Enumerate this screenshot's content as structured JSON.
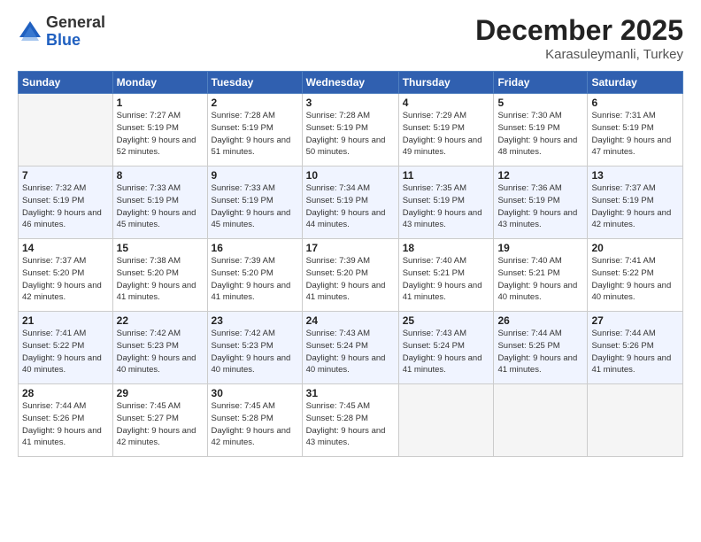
{
  "logo": {
    "general": "General",
    "blue": "Blue"
  },
  "title": "December 2025",
  "location": "Karasuleymanli, Turkey",
  "days_header": [
    "Sunday",
    "Monday",
    "Tuesday",
    "Wednesday",
    "Thursday",
    "Friday",
    "Saturday"
  ],
  "weeks": [
    [
      {
        "day": "",
        "sunrise": "",
        "sunset": "",
        "daylight": ""
      },
      {
        "day": "1",
        "sunrise": "Sunrise: 7:27 AM",
        "sunset": "Sunset: 5:19 PM",
        "daylight": "Daylight: 9 hours and 52 minutes."
      },
      {
        "day": "2",
        "sunrise": "Sunrise: 7:28 AM",
        "sunset": "Sunset: 5:19 PM",
        "daylight": "Daylight: 9 hours and 51 minutes."
      },
      {
        "day": "3",
        "sunrise": "Sunrise: 7:28 AM",
        "sunset": "Sunset: 5:19 PM",
        "daylight": "Daylight: 9 hours and 50 minutes."
      },
      {
        "day": "4",
        "sunrise": "Sunrise: 7:29 AM",
        "sunset": "Sunset: 5:19 PM",
        "daylight": "Daylight: 9 hours and 49 minutes."
      },
      {
        "day": "5",
        "sunrise": "Sunrise: 7:30 AM",
        "sunset": "Sunset: 5:19 PM",
        "daylight": "Daylight: 9 hours and 48 minutes."
      },
      {
        "day": "6",
        "sunrise": "Sunrise: 7:31 AM",
        "sunset": "Sunset: 5:19 PM",
        "daylight": "Daylight: 9 hours and 47 minutes."
      }
    ],
    [
      {
        "day": "7",
        "sunrise": "Sunrise: 7:32 AM",
        "sunset": "Sunset: 5:19 PM",
        "daylight": "Daylight: 9 hours and 46 minutes."
      },
      {
        "day": "8",
        "sunrise": "Sunrise: 7:33 AM",
        "sunset": "Sunset: 5:19 PM",
        "daylight": "Daylight: 9 hours and 45 minutes."
      },
      {
        "day": "9",
        "sunrise": "Sunrise: 7:33 AM",
        "sunset": "Sunset: 5:19 PM",
        "daylight": "Daylight: 9 hours and 45 minutes."
      },
      {
        "day": "10",
        "sunrise": "Sunrise: 7:34 AM",
        "sunset": "Sunset: 5:19 PM",
        "daylight": "Daylight: 9 hours and 44 minutes."
      },
      {
        "day": "11",
        "sunrise": "Sunrise: 7:35 AM",
        "sunset": "Sunset: 5:19 PM",
        "daylight": "Daylight: 9 hours and 43 minutes."
      },
      {
        "day": "12",
        "sunrise": "Sunrise: 7:36 AM",
        "sunset": "Sunset: 5:19 PM",
        "daylight": "Daylight: 9 hours and 43 minutes."
      },
      {
        "day": "13",
        "sunrise": "Sunrise: 7:37 AM",
        "sunset": "Sunset: 5:19 PM",
        "daylight": "Daylight: 9 hours and 42 minutes."
      }
    ],
    [
      {
        "day": "14",
        "sunrise": "Sunrise: 7:37 AM",
        "sunset": "Sunset: 5:20 PM",
        "daylight": "Daylight: 9 hours and 42 minutes."
      },
      {
        "day": "15",
        "sunrise": "Sunrise: 7:38 AM",
        "sunset": "Sunset: 5:20 PM",
        "daylight": "Daylight: 9 hours and 41 minutes."
      },
      {
        "day": "16",
        "sunrise": "Sunrise: 7:39 AM",
        "sunset": "Sunset: 5:20 PM",
        "daylight": "Daylight: 9 hours and 41 minutes."
      },
      {
        "day": "17",
        "sunrise": "Sunrise: 7:39 AM",
        "sunset": "Sunset: 5:20 PM",
        "daylight": "Daylight: 9 hours and 41 minutes."
      },
      {
        "day": "18",
        "sunrise": "Sunrise: 7:40 AM",
        "sunset": "Sunset: 5:21 PM",
        "daylight": "Daylight: 9 hours and 41 minutes."
      },
      {
        "day": "19",
        "sunrise": "Sunrise: 7:40 AM",
        "sunset": "Sunset: 5:21 PM",
        "daylight": "Daylight: 9 hours and 40 minutes."
      },
      {
        "day": "20",
        "sunrise": "Sunrise: 7:41 AM",
        "sunset": "Sunset: 5:22 PM",
        "daylight": "Daylight: 9 hours and 40 minutes."
      }
    ],
    [
      {
        "day": "21",
        "sunrise": "Sunrise: 7:41 AM",
        "sunset": "Sunset: 5:22 PM",
        "daylight": "Daylight: 9 hours and 40 minutes."
      },
      {
        "day": "22",
        "sunrise": "Sunrise: 7:42 AM",
        "sunset": "Sunset: 5:23 PM",
        "daylight": "Daylight: 9 hours and 40 minutes."
      },
      {
        "day": "23",
        "sunrise": "Sunrise: 7:42 AM",
        "sunset": "Sunset: 5:23 PM",
        "daylight": "Daylight: 9 hours and 40 minutes."
      },
      {
        "day": "24",
        "sunrise": "Sunrise: 7:43 AM",
        "sunset": "Sunset: 5:24 PM",
        "daylight": "Daylight: 9 hours and 40 minutes."
      },
      {
        "day": "25",
        "sunrise": "Sunrise: 7:43 AM",
        "sunset": "Sunset: 5:24 PM",
        "daylight": "Daylight: 9 hours and 41 minutes."
      },
      {
        "day": "26",
        "sunrise": "Sunrise: 7:44 AM",
        "sunset": "Sunset: 5:25 PM",
        "daylight": "Daylight: 9 hours and 41 minutes."
      },
      {
        "day": "27",
        "sunrise": "Sunrise: 7:44 AM",
        "sunset": "Sunset: 5:26 PM",
        "daylight": "Daylight: 9 hours and 41 minutes."
      }
    ],
    [
      {
        "day": "28",
        "sunrise": "Sunrise: 7:44 AM",
        "sunset": "Sunset: 5:26 PM",
        "daylight": "Daylight: 9 hours and 41 minutes."
      },
      {
        "day": "29",
        "sunrise": "Sunrise: 7:45 AM",
        "sunset": "Sunset: 5:27 PM",
        "daylight": "Daylight: 9 hours and 42 minutes."
      },
      {
        "day": "30",
        "sunrise": "Sunrise: 7:45 AM",
        "sunset": "Sunset: 5:28 PM",
        "daylight": "Daylight: 9 hours and 42 minutes."
      },
      {
        "day": "31",
        "sunrise": "Sunrise: 7:45 AM",
        "sunset": "Sunset: 5:28 PM",
        "daylight": "Daylight: 9 hours and 43 minutes."
      },
      {
        "day": "",
        "sunrise": "",
        "sunset": "",
        "daylight": ""
      },
      {
        "day": "",
        "sunrise": "",
        "sunset": "",
        "daylight": ""
      },
      {
        "day": "",
        "sunrise": "",
        "sunset": "",
        "daylight": ""
      }
    ]
  ]
}
